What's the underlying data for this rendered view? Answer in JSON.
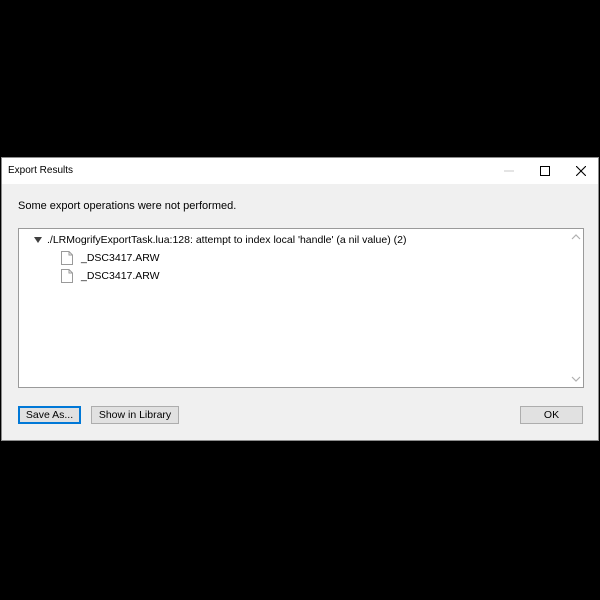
{
  "dialog": {
    "title": "Export Results",
    "message": "Some export operations were not performed."
  },
  "window_controls": {
    "minimize_icon": "minimize-icon",
    "maximize_icon": "maximize-icon",
    "close_icon": "close-icon"
  },
  "results": {
    "error": {
      "label": "./LRMogrifyExportTask.lua:128: attempt to index local 'handle' (a nil value) (2)",
      "expanded": true,
      "files": [
        {
          "name": "_DSC3417.ARW",
          "icon": "file-icon"
        },
        {
          "name": "_DSC3417.ARW",
          "icon": "file-icon"
        }
      ]
    }
  },
  "buttons": {
    "save_as": "Save As...",
    "show_in_library": "Show in Library",
    "ok": "OK"
  },
  "colors": {
    "background": "#000000",
    "dialog_bg": "#f0f0f0",
    "focus_border": "#0078d7"
  }
}
